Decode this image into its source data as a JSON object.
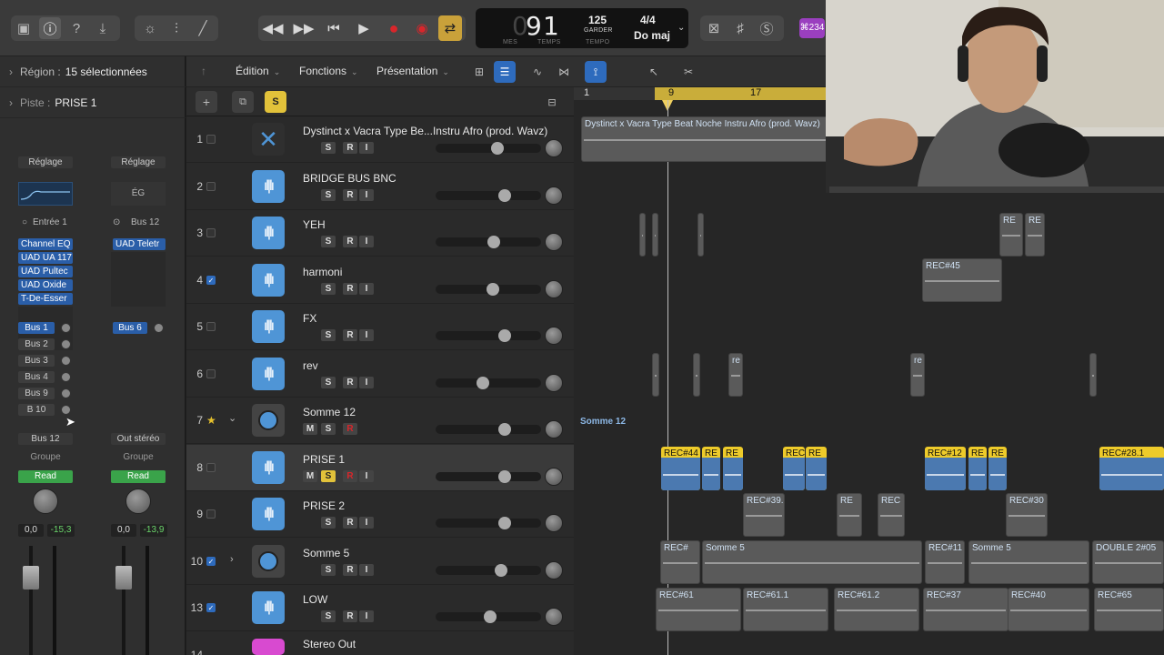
{
  "topbar": {
    "lcd": {
      "bar": "9",
      "beat": "1",
      "bar_label": "MES",
      "beat_label": "TEMPS",
      "tempo": "125",
      "tempo_mode": "GARDER",
      "tempo_label": "TEMPO",
      "signature": "4/4",
      "key": "Do maj"
    },
    "badge": "⌘234"
  },
  "inspector": {
    "region_label": "Région :",
    "region_value": "15 sélectionnées",
    "track_label": "Piste :",
    "track_value": "PRISE 1",
    "strip1": {
      "setting": "Réglage",
      "input": "Entrée 1",
      "plugins": [
        "Channel EQ",
        "UAD UA 117",
        "UAD Pultec",
        "UAD Oxide",
        "T-De-Esser"
      ],
      "sends": [
        "Bus 1",
        "Bus 2",
        "Bus 3",
        "Bus 4",
        "Bus 9",
        "B 10"
      ],
      "output": "Bus 12",
      "group": "Groupe",
      "automation": "Read",
      "volume": "0,0",
      "peak": "-15,3"
    },
    "strip2": {
      "setting": "Réglage",
      "eq": "ÉG",
      "input": "Bus 12",
      "plugins": [
        "UAD Teletr"
      ],
      "sends": [
        "Bus 6"
      ],
      "output": "Out stéréo",
      "group": "Groupe",
      "automation": "Read",
      "volume": "0,0",
      "peak": "-13,9"
    }
  },
  "menubar": {
    "edit": "Édition",
    "functions": "Fonctions",
    "view": "Présentation",
    "solo_badge": "S"
  },
  "ruler": {
    "marks": [
      "1",
      "9",
      "17"
    ]
  },
  "tracks": [
    {
      "num": "1",
      "name": "Dystinct x Vacra Type Be...Instru Afro (prod. Wavz)",
      "m": "",
      "s": "S",
      "r": "R",
      "i": "I",
      "checked": false,
      "vol": 0.6
    },
    {
      "num": "2",
      "name": "BRIDGE BUS BNC",
      "m": "",
      "s": "S",
      "r": "R",
      "i": "I",
      "checked": false,
      "vol": 0.68
    },
    {
      "num": "3",
      "name": "YEH",
      "m": "",
      "s": "S",
      "r": "R",
      "i": "I",
      "checked": false,
      "vol": 0.56
    },
    {
      "num": "4",
      "name": "harmoni",
      "m": "",
      "s": "S",
      "r": "R",
      "i": "I",
      "checked": true,
      "vol": 0.55
    },
    {
      "num": "5",
      "name": "FX",
      "m": "",
      "s": "S",
      "r": "R",
      "i": "I",
      "checked": false,
      "vol": 0.68
    },
    {
      "num": "6",
      "name": "rev",
      "m": "",
      "s": "S",
      "r": "R",
      "i": "I",
      "checked": false,
      "vol": 0.44
    },
    {
      "num": "7",
      "name": "Somme 12",
      "m": "M",
      "s": "S",
      "r": "R",
      "i": "",
      "checked": false,
      "vol": 0.68
    },
    {
      "num": "8",
      "name": "PRISE 1",
      "m": "M",
      "s": "S",
      "r": "R",
      "i": "I",
      "checked": false,
      "vol": 0.68
    },
    {
      "num": "9",
      "name": "PRISE 2",
      "m": "",
      "s": "S",
      "r": "R",
      "i": "I",
      "checked": false,
      "vol": 0.68
    },
    {
      "num": "10",
      "name": "Somme 5",
      "m": "",
      "s": "S",
      "r": "R",
      "i": "I",
      "checked": true,
      "vol": 0.64
    },
    {
      "num": "13",
      "name": "LOW",
      "m": "",
      "s": "S",
      "r": "R",
      "i": "I",
      "checked": true,
      "vol": 0.52
    },
    {
      "num": "14",
      "name": "Stereo Out",
      "m": "",
      "s": "",
      "r": "",
      "i": "",
      "checked": false,
      "vol": 0.5
    }
  ],
  "regions": {
    "r1": "Dystinct x Vacra Type Beat Noche  Instru Afro (prod. Wavz)",
    "somme12": "Somme 12",
    "prise1": [
      "REC#44",
      "RE",
      "RE",
      "REC",
      "RE",
      "REC#12",
      "RE",
      "RE",
      "REC#28.1"
    ],
    "prise2": [
      "REC#39.",
      "RE",
      "REC",
      "REC#30"
    ],
    "somme5": [
      "REC#",
      "Somme 5",
      "REC#11",
      "Somme 5",
      "DOUBLE 2#05"
    ],
    "low": [
      "REC#61",
      "REC#61.1",
      "REC#61.2",
      "REC#37",
      "REC#40",
      "REC#65"
    ],
    "yeh": [
      "RE",
      "RE"
    ],
    "harmoni": "REC#45",
    "rev": [
      "re",
      "re"
    ]
  },
  "colors": {
    "accent_blue": "#4f95d6",
    "region_yellow": "#eecb2a",
    "read_green": "#3aa34a",
    "record_red": "#d8262b"
  }
}
